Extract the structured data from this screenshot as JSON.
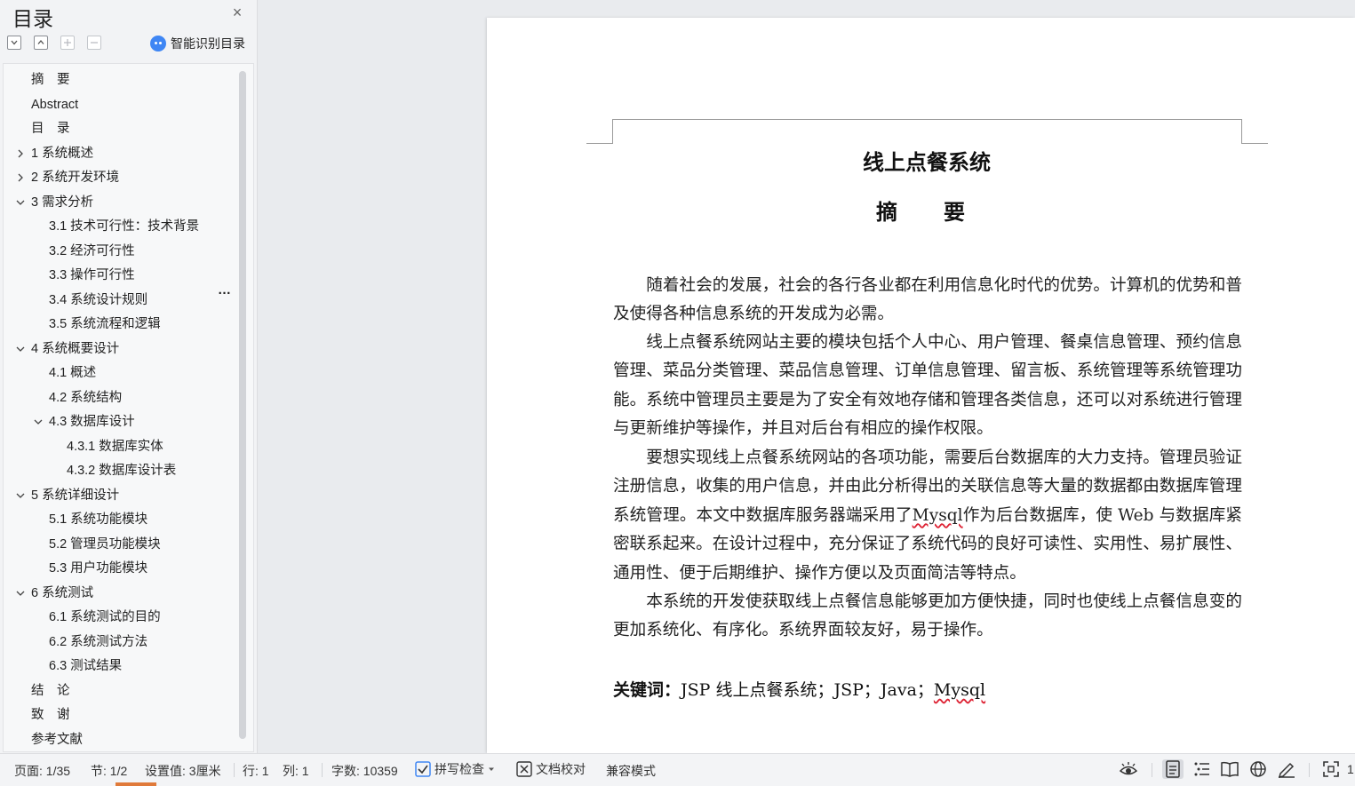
{
  "sidebar": {
    "title": "目录",
    "smart_toc_label": "智能识别目录",
    "toc_items": [
      {
        "label": "摘　要",
        "level": 0,
        "expandable": false,
        "expanded": false
      },
      {
        "label": "Abstract",
        "level": 0,
        "expandable": false,
        "expanded": false
      },
      {
        "label": "目　录",
        "level": 0,
        "expandable": false,
        "expanded": false
      },
      {
        "label": "1  系统概述",
        "level": 0,
        "expandable": true,
        "expanded": false
      },
      {
        "label": "2  系统开发环境",
        "level": 0,
        "expandable": true,
        "expanded": false
      },
      {
        "label": "3  需求分析",
        "level": 0,
        "expandable": true,
        "expanded": true
      },
      {
        "label": "3.1 技术可行性：技术背景",
        "level": 1,
        "expandable": false,
        "expanded": false
      },
      {
        "label": "3.2 经济可行性",
        "level": 1,
        "expandable": false,
        "expanded": false
      },
      {
        "label": "3.3 操作可行性",
        "level": 1,
        "expandable": false,
        "expanded": false
      },
      {
        "label": "3.4 系统设计规则",
        "level": 1,
        "expandable": false,
        "expanded": false
      },
      {
        "label": "3.5 系统流程和逻辑",
        "level": 1,
        "expandable": false,
        "expanded": false
      },
      {
        "label": "4  系统概要设计",
        "level": 0,
        "expandable": true,
        "expanded": true
      },
      {
        "label": "4.1 概述",
        "level": 1,
        "expandable": false,
        "expanded": false
      },
      {
        "label": "4.2 系统结构",
        "level": 1,
        "expandable": false,
        "expanded": false
      },
      {
        "label": "4.3 数据库设计",
        "level": 1,
        "expandable": true,
        "expanded": true
      },
      {
        "label": "4.3.1  数据库实体",
        "level": 2,
        "expandable": false,
        "expanded": false
      },
      {
        "label": "4.3.2  数据库设计表",
        "level": 2,
        "expandable": false,
        "expanded": false
      },
      {
        "label": "5  系统详细设计",
        "level": 0,
        "expandable": true,
        "expanded": true
      },
      {
        "label": "5.1 系统功能模块",
        "level": 1,
        "expandable": false,
        "expanded": false
      },
      {
        "label": "5.2 管理员功能模块",
        "level": 1,
        "expandable": false,
        "expanded": false
      },
      {
        "label": "5.3 用户功能模块",
        "level": 1,
        "expandable": false,
        "expanded": false
      },
      {
        "label": "6  系统测试",
        "level": 0,
        "expandable": true,
        "expanded": true
      },
      {
        "label": "6.1 系统测试的目的",
        "level": 1,
        "expandable": false,
        "expanded": false
      },
      {
        "label": "6.2 系统测试方法",
        "level": 1,
        "expandable": false,
        "expanded": false
      },
      {
        "label": "6.3 测试结果",
        "level": 1,
        "expandable": false,
        "expanded": false
      },
      {
        "label": "结　论",
        "level": 0,
        "expandable": false,
        "expanded": false
      },
      {
        "label": "致　谢",
        "level": 0,
        "expandable": false,
        "expanded": false
      },
      {
        "label": "参考文献",
        "level": 0,
        "expandable": false,
        "expanded": false
      }
    ],
    "more_label": "…"
  },
  "document": {
    "title": "线上点餐系统",
    "abstract_heading": "摘　要",
    "p1": "随着社会的发展，社会的各行各业都在利用信息化时代的优势。计算机的优势和普及使得各种信息系统的开发成为必需。",
    "p2": "线上点餐系统网站主要的模块包括个人中心、用户管理、餐桌信息管理、预约信息管理、菜品分类管理、菜品信息管理、订单信息管理、留言板、系统管理等系统管理功能。系统中管理员主要是为了安全有效地存储和管理各类信息，还可以对系统进行管理与更新维护等操作，并且对后台有相应的操作权限。",
    "p3_a": "要想实现线上点餐系统网站的各项功能，需要后台数据库的大力支持。管理员验证注册信息，收集的用户信息，并由此分析得出的关联信息等大量的数据都由数据库管理系统管理。本文中数据库服务器端采用了",
    "p3_mysql": "Mysql",
    "p3_b": "作为后台数据库，使 Web 与数据库紧密联系起来。在设计过程中，充分保证了系统代码的良好可读性、实用性、易扩展性、通用性、便于后期维护、操作方便以及页面简洁等特点。",
    "p4": "本系统的开发使获取线上点餐信息能够更加方便快捷，同时也使线上点餐信息变的更加系统化、有序化。系统界面较友好，易于操作。",
    "keywords_label": "关键词：",
    "keywords_a": "JSP 线上点餐系统；JSP；Java；",
    "keywords_mysql": "Mysql"
  },
  "statusbar": {
    "page": "页面: 1/35",
    "section": "节: 1/2",
    "setting": "设置值: 3厘米",
    "row": "行: 1",
    "col": "列: 1",
    "word_count": "字数: 10359",
    "spell_check": "拼写检查",
    "doc_proof": "文档校对",
    "compat_mode": "兼容模式",
    "zoom_digit": "1"
  },
  "colors": {
    "accent_blue": "#3f86f4",
    "spell_underline": "#d23",
    "status_orange": "#e07a3a"
  }
}
